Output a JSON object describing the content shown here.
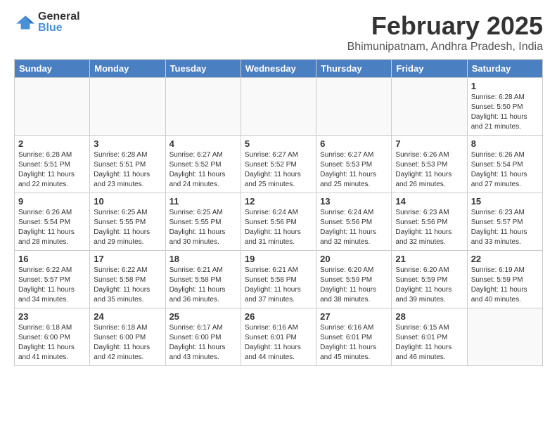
{
  "app": {
    "logo_general": "General",
    "logo_blue": "Blue"
  },
  "header": {
    "title": "February 2025",
    "location": "Bhimunipatnam, Andhra Pradesh, India"
  },
  "columns": [
    "Sunday",
    "Monday",
    "Tuesday",
    "Wednesday",
    "Thursday",
    "Friday",
    "Saturday"
  ],
  "weeks": [
    [
      {
        "day": "",
        "info": ""
      },
      {
        "day": "",
        "info": ""
      },
      {
        "day": "",
        "info": ""
      },
      {
        "day": "",
        "info": ""
      },
      {
        "day": "",
        "info": ""
      },
      {
        "day": "",
        "info": ""
      },
      {
        "day": "1",
        "info": "Sunrise: 6:28 AM\nSunset: 5:50 PM\nDaylight: 11 hours\nand 21 minutes."
      }
    ],
    [
      {
        "day": "2",
        "info": "Sunrise: 6:28 AM\nSunset: 5:51 PM\nDaylight: 11 hours\nand 22 minutes."
      },
      {
        "day": "3",
        "info": "Sunrise: 6:28 AM\nSunset: 5:51 PM\nDaylight: 11 hours\nand 23 minutes."
      },
      {
        "day": "4",
        "info": "Sunrise: 6:27 AM\nSunset: 5:52 PM\nDaylight: 11 hours\nand 24 minutes."
      },
      {
        "day": "5",
        "info": "Sunrise: 6:27 AM\nSunset: 5:52 PM\nDaylight: 11 hours\nand 25 minutes."
      },
      {
        "day": "6",
        "info": "Sunrise: 6:27 AM\nSunset: 5:53 PM\nDaylight: 11 hours\nand 25 minutes."
      },
      {
        "day": "7",
        "info": "Sunrise: 6:26 AM\nSunset: 5:53 PM\nDaylight: 11 hours\nand 26 minutes."
      },
      {
        "day": "8",
        "info": "Sunrise: 6:26 AM\nSunset: 5:54 PM\nDaylight: 11 hours\nand 27 minutes."
      }
    ],
    [
      {
        "day": "9",
        "info": "Sunrise: 6:26 AM\nSunset: 5:54 PM\nDaylight: 11 hours\nand 28 minutes."
      },
      {
        "day": "10",
        "info": "Sunrise: 6:25 AM\nSunset: 5:55 PM\nDaylight: 11 hours\nand 29 minutes."
      },
      {
        "day": "11",
        "info": "Sunrise: 6:25 AM\nSunset: 5:55 PM\nDaylight: 11 hours\nand 30 minutes."
      },
      {
        "day": "12",
        "info": "Sunrise: 6:24 AM\nSunset: 5:56 PM\nDaylight: 11 hours\nand 31 minutes."
      },
      {
        "day": "13",
        "info": "Sunrise: 6:24 AM\nSunset: 5:56 PM\nDaylight: 11 hours\nand 32 minutes."
      },
      {
        "day": "14",
        "info": "Sunrise: 6:23 AM\nSunset: 5:56 PM\nDaylight: 11 hours\nand 32 minutes."
      },
      {
        "day": "15",
        "info": "Sunrise: 6:23 AM\nSunset: 5:57 PM\nDaylight: 11 hours\nand 33 minutes."
      }
    ],
    [
      {
        "day": "16",
        "info": "Sunrise: 6:22 AM\nSunset: 5:57 PM\nDaylight: 11 hours\nand 34 minutes."
      },
      {
        "day": "17",
        "info": "Sunrise: 6:22 AM\nSunset: 5:58 PM\nDaylight: 11 hours\nand 35 minutes."
      },
      {
        "day": "18",
        "info": "Sunrise: 6:21 AM\nSunset: 5:58 PM\nDaylight: 11 hours\nand 36 minutes."
      },
      {
        "day": "19",
        "info": "Sunrise: 6:21 AM\nSunset: 5:58 PM\nDaylight: 11 hours\nand 37 minutes."
      },
      {
        "day": "20",
        "info": "Sunrise: 6:20 AM\nSunset: 5:59 PM\nDaylight: 11 hours\nand 38 minutes."
      },
      {
        "day": "21",
        "info": "Sunrise: 6:20 AM\nSunset: 5:59 PM\nDaylight: 11 hours\nand 39 minutes."
      },
      {
        "day": "22",
        "info": "Sunrise: 6:19 AM\nSunset: 5:59 PM\nDaylight: 11 hours\nand 40 minutes."
      }
    ],
    [
      {
        "day": "23",
        "info": "Sunrise: 6:18 AM\nSunset: 6:00 PM\nDaylight: 11 hours\nand 41 minutes."
      },
      {
        "day": "24",
        "info": "Sunrise: 6:18 AM\nSunset: 6:00 PM\nDaylight: 11 hours\nand 42 minutes."
      },
      {
        "day": "25",
        "info": "Sunrise: 6:17 AM\nSunset: 6:00 PM\nDaylight: 11 hours\nand 43 minutes."
      },
      {
        "day": "26",
        "info": "Sunrise: 6:16 AM\nSunset: 6:01 PM\nDaylight: 11 hours\nand 44 minutes."
      },
      {
        "day": "27",
        "info": "Sunrise: 6:16 AM\nSunset: 6:01 PM\nDaylight: 11 hours\nand 45 minutes."
      },
      {
        "day": "28",
        "info": "Sunrise: 6:15 AM\nSunset: 6:01 PM\nDaylight: 11 hours\nand 46 minutes."
      },
      {
        "day": "",
        "info": ""
      }
    ]
  ]
}
